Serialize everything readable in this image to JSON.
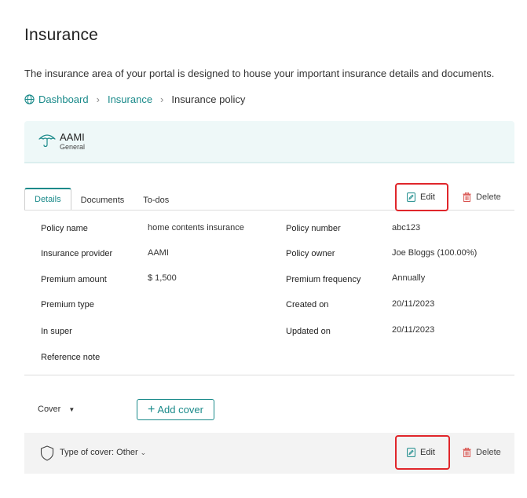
{
  "page": {
    "title": "Insurance",
    "description": "The insurance area of your portal is designed to house your important insurance details and documents."
  },
  "breadcrumb": {
    "items": [
      "Dashboard",
      "Insurance",
      "Insurance policy"
    ]
  },
  "policy": {
    "name": "AAMI",
    "type": "General"
  },
  "tabs": [
    {
      "label": "Details",
      "active": true
    },
    {
      "label": "Documents",
      "active": false
    },
    {
      "label": "To-dos",
      "active": false
    }
  ],
  "actions": {
    "edit_label": "Edit",
    "delete_label": "Delete"
  },
  "details": {
    "left": [
      {
        "label": "Policy name",
        "value": "home contents insurance"
      },
      {
        "label": "Insurance provider",
        "value": "AAMI"
      },
      {
        "label": "Premium amount",
        "value": "$ 1,500"
      },
      {
        "label": "Premium type",
        "value": ""
      },
      {
        "label": "In super",
        "value": ""
      },
      {
        "label": "Reference note",
        "value": ""
      }
    ],
    "right": [
      {
        "label": "Policy number",
        "value": "abc123"
      },
      {
        "label": "Policy owner",
        "value": "Joe Bloggs (100.00%)"
      },
      {
        "label": "Premium frequency",
        "value": "Annually"
      },
      {
        "label": "Created on",
        "value": "20/11/2023"
      },
      {
        "label": "Updated on",
        "value": "20/11/2023"
      }
    ]
  },
  "cover": {
    "select_label": "Cover",
    "add_button": "Add cover",
    "item_label": "Type of cover: Other"
  },
  "colors": {
    "accent": "#1a8a8a",
    "highlight": "#e0262b",
    "delete": "#d9534f",
    "card_bg": "#eef8f8",
    "row_bg": "#f3f3f3"
  }
}
